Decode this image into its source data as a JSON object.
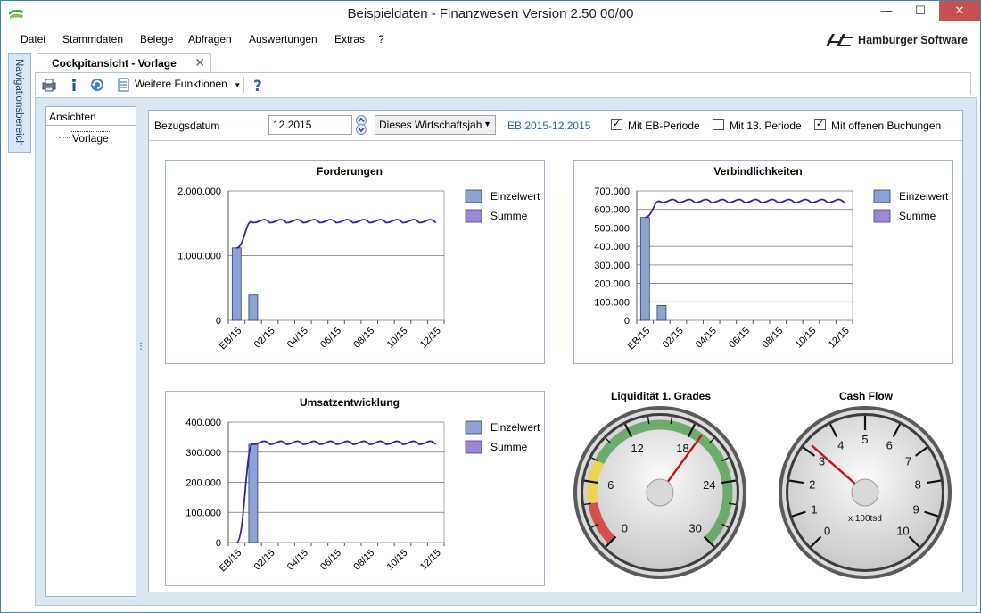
{
  "window": {
    "title": "Beispieldaten - Finanzwesen Version 2.50 00/00",
    "minimize": "—",
    "maximize": "☐",
    "close": "✕"
  },
  "menu": [
    {
      "label": "Datei"
    },
    {
      "label": "Stammdaten"
    },
    {
      "label": "Belege"
    },
    {
      "label": "Abfragen"
    },
    {
      "label": "Auswertungen"
    },
    {
      "label": "Extras"
    },
    {
      "label": "?"
    }
  ],
  "brand": "Hamburger Software",
  "nav_side": "Navigationsbereich",
  "tab": {
    "label": "Cockpitansicht - Vorlage",
    "close": "✕"
  },
  "toolbar": {
    "functions_label": "Weitere Funktionen",
    "icons": [
      "printer-icon",
      "info-icon",
      "refresh-icon",
      "functions-icon",
      "help-icon"
    ]
  },
  "tree": {
    "header": "Ansichten",
    "item": "Vorlage"
  },
  "filter": {
    "label": "Bezugsdatum",
    "date_value": "12.2015",
    "period_select": "Dieses Wirtschaftsjah",
    "range_text": "EB.2015-12.2015",
    "eb_label": "Mit EB-Periode",
    "eb_checked": true,
    "p13_label": "Mit 13. Periode",
    "p13_checked": false,
    "open_label": "Mit offenen Buchungen",
    "open_checked": true
  },
  "legend": {
    "single": "Einzelwert",
    "sum": "Summe"
  },
  "colors": {
    "bar": "#8ea3d3",
    "line": "#3a1fa8",
    "sum_swatch": "#9b87d6"
  },
  "chart_data": [
    {
      "type": "bar",
      "title": "Forderungen",
      "categories": [
        "EB/15",
        "01/15",
        "02/15",
        "03/15",
        "04/15",
        "05/15",
        "06/15",
        "07/15",
        "08/15",
        "09/15",
        "10/15",
        "11/15",
        "12/15"
      ],
      "tick_labels": [
        "EB/15",
        "02/15",
        "04/15",
        "06/15",
        "08/15",
        "10/15",
        "12/15"
      ],
      "ytick_labels": [
        "0",
        "1.000.000",
        "2.000.000"
      ],
      "ylim": [
        0,
        2000000
      ],
      "series": [
        {
          "name": "Einzelwert",
          "values": [
            1120000,
            390000,
            0,
            0,
            0,
            0,
            0,
            0,
            0,
            0,
            0,
            0,
            0
          ]
        },
        {
          "name": "Summe",
          "values": [
            1120000,
            1510000,
            1510000,
            1510000,
            1510000,
            1510000,
            1510000,
            1510000,
            1510000,
            1510000,
            1510000,
            1510000,
            1510000
          ]
        }
      ]
    },
    {
      "type": "bar",
      "title": "Verbindlichkeiten",
      "categories": [
        "EB/15",
        "01/15",
        "02/15",
        "03/15",
        "04/15",
        "05/15",
        "06/15",
        "07/15",
        "08/15",
        "09/15",
        "10/15",
        "11/15",
        "12/15"
      ],
      "tick_labels": [
        "EB/15",
        "02/15",
        "04/15",
        "06/15",
        "08/15",
        "10/15",
        "12/15"
      ],
      "ytick_labels": [
        "0",
        "100.000",
        "200.000",
        "300.000",
        "400.000",
        "500.000",
        "600.000",
        "700.000"
      ],
      "ylim": [
        0,
        700000
      ],
      "series": [
        {
          "name": "Einzelwert",
          "values": [
            557000,
            80000,
            0,
            0,
            0,
            0,
            0,
            0,
            0,
            0,
            0,
            0,
            0
          ]
        },
        {
          "name": "Summe",
          "values": [
            557000,
            637000,
            637000,
            637000,
            637000,
            637000,
            637000,
            637000,
            637000,
            637000,
            637000,
            637000,
            637000
          ]
        }
      ]
    },
    {
      "type": "bar",
      "title": "Umsatzentwicklung",
      "categories": [
        "EB/15",
        "01/15",
        "02/15",
        "03/15",
        "04/15",
        "05/15",
        "06/15",
        "07/15",
        "08/15",
        "09/15",
        "10/15",
        "11/15",
        "12/15"
      ],
      "tick_labels": [
        "EB/15",
        "02/15",
        "04/15",
        "06/15",
        "08/15",
        "10/15",
        "12/15"
      ],
      "ytick_labels": [
        "0",
        "100.000",
        "200.000",
        "300.000",
        "400.000"
      ],
      "ylim": [
        0,
        400000
      ],
      "series": [
        {
          "name": "Einzelwert",
          "values": [
            0,
            326000,
            0,
            0,
            0,
            0,
            0,
            0,
            0,
            0,
            0,
            0,
            0
          ]
        },
        {
          "name": "Summe",
          "values": [
            0,
            326000,
            326000,
            326000,
            326000,
            326000,
            326000,
            326000,
            326000,
            326000,
            326000,
            326000,
            326000
          ]
        }
      ]
    }
  ],
  "gauges": [
    {
      "title": "Liquidität 1. Grades",
      "labels": [
        "0",
        "6",
        "12",
        "18",
        "24",
        "30"
      ],
      "min": 0,
      "max": 30,
      "value": 19,
      "bands": [
        {
          "from": 0,
          "to": 4,
          "color": "#d33a3a"
        },
        {
          "from": 4,
          "to": 8,
          "color": "#f1d23a"
        },
        {
          "from": 8,
          "to": 30,
          "color": "#5aa35a"
        }
      ]
    },
    {
      "title": "Cash Flow",
      "labels": [
        "0",
        "1",
        "2",
        "3",
        "4",
        "5",
        "6",
        "7",
        "8",
        "9",
        "10"
      ],
      "min": 0,
      "max": 10,
      "value": 3.2,
      "unit": "x 100tsd"
    }
  ]
}
